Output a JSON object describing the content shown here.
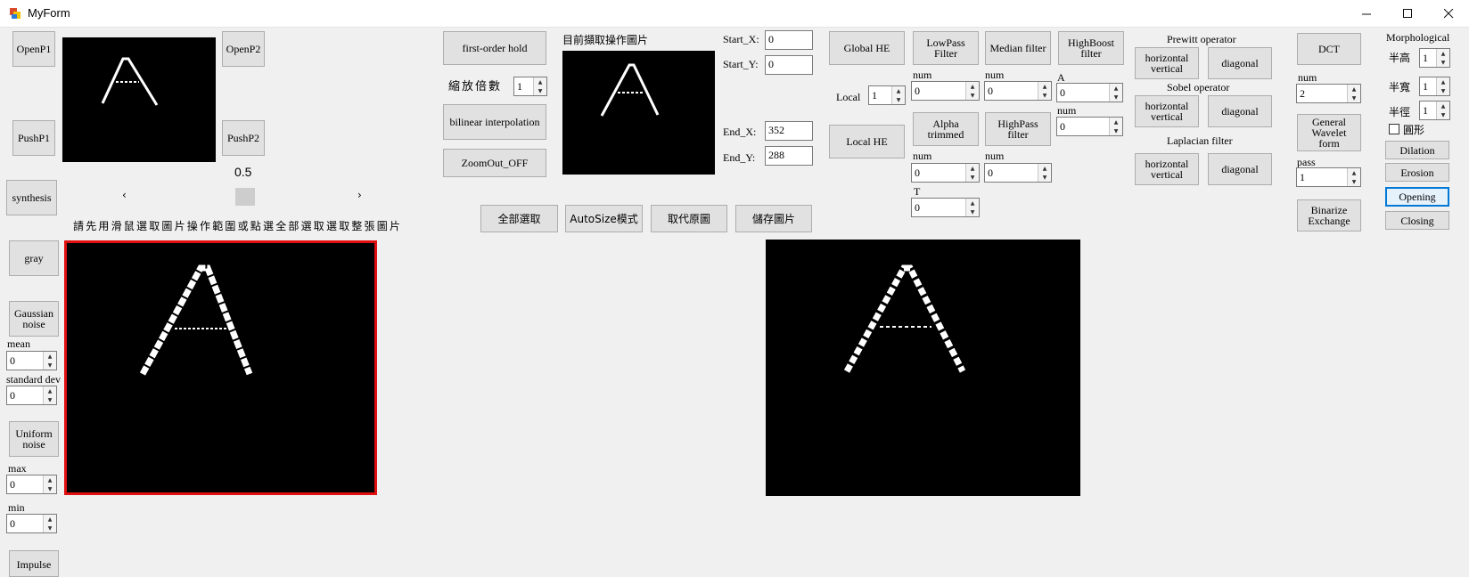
{
  "window": {
    "title": "MyForm",
    "minimize_icon": "minimize-icon",
    "maximize_icon": "maximize-icon",
    "close_icon": "close-icon"
  },
  "left": {
    "openp1": "OpenP1",
    "pushp1": "PushP1",
    "openp2": "OpenP2",
    "pushp2": "PushP2",
    "synthesis": "synthesis",
    "gray": "gray",
    "gaussian": "Gaussian\nnoise",
    "mean_label": "mean",
    "mean_value": "0",
    "std_label": "standard dev",
    "std_value": "0",
    "uniform": "Uniform\nnoise",
    "max_label": "max",
    "max_value": "0",
    "min_label": "min",
    "min_value": "0",
    "impulse": "Impulse",
    "scroll_value": "0.5",
    "hint": "請先用滑鼠選取圖片操作範圍或點選全部選取選取整張圖片"
  },
  "zoom": {
    "first_order": "first-order hold",
    "scale_label": "縮放倍數",
    "scale_value": "1",
    "bilinear": "bilinear interpolation",
    "zoomout": "ZoomOut_OFF",
    "current_label": "目前擷取操作圖片",
    "start_x_label": "Start_X:",
    "start_x": "0",
    "start_y_label": "Start_Y:",
    "start_y": "0",
    "end_x_label": "End_X:",
    "end_x": "352",
    "end_y_label": "End_Y:",
    "end_y": "288",
    "select_all": "全部選取",
    "autosize": "AutoSize模式",
    "replace": "取代原圖",
    "save": "儲存圖片"
  },
  "filters": {
    "global_he": "Global HE",
    "local_label": "Local",
    "local_value": "1",
    "local_he": "Local HE",
    "lowpass": "LowPass\nFilter",
    "lowpass_num_label": "num",
    "lowpass_num": "0",
    "median": "Median filter",
    "median_num_label": "num",
    "median_num": "0",
    "highboost": "HighBoost\nfilter",
    "a_label": "A",
    "a_value": "0",
    "hb_num_label": "num",
    "hb_num": "0",
    "alpha": "Alpha\ntrimmed",
    "alpha_num_label": "num",
    "alpha_num": "0",
    "t_label": "T",
    "t_value": "0",
    "highpass": "HighPass\nfilter",
    "hp_num_label": "num",
    "hp_num": "0"
  },
  "edge": {
    "prewitt": "Prewitt operator",
    "prewitt_hv": "horizontal\nvertical",
    "prewitt_diag": "diagonal",
    "sobel": "Sobel operator",
    "sobel_hv": "horizontal\nvertical",
    "sobel_diag": "diagonal",
    "laplacian": "Laplacian filter",
    "lap_hv": "horizontal\nvertical",
    "lap_diag": "diagonal"
  },
  "transform": {
    "dct": "DCT",
    "num_label": "num",
    "num_value": "2",
    "wavelet": "General\nWavelet\nform",
    "pass_label": "pass",
    "pass_value": "1",
    "binarize": "Binarize\nExchange"
  },
  "morph": {
    "title": "Morphological",
    "height_label": "半高",
    "height_value": "1",
    "width_label": "半寬",
    "width_value": "1",
    "radius_label": "半徑",
    "radius_value": "1",
    "circle_label": "圓形",
    "dilation": "Dilation",
    "erosion": "Erosion",
    "opening": "Opening",
    "closing": "Closing"
  }
}
